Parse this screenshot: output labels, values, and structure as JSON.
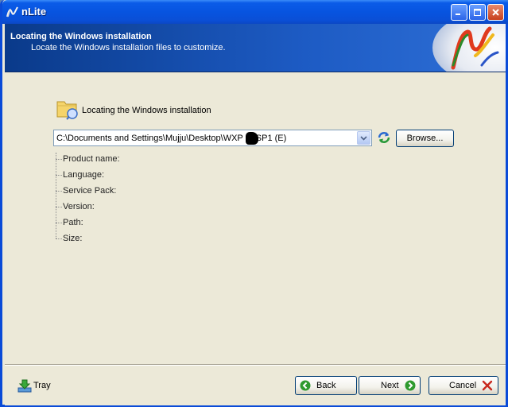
{
  "window": {
    "title": "nLite"
  },
  "header": {
    "title": "Locating the Windows installation",
    "subtitle": "Locate the Windows installation files to customize."
  },
  "section": {
    "label": "Locating the Windows installation"
  },
  "path_combo": {
    "value": "C:\\Documents and Settings\\Mujju\\Desktop\\WXP    SP1 (E)",
    "value_left": "C:\\Documents and Settings\\Mujju\\Desktop\\WXP",
    "value_right": "SP1 (E)"
  },
  "browse_label": "Browse...",
  "info": {
    "items": [
      {
        "label": "Product name:"
      },
      {
        "label": "Language:"
      },
      {
        "label": "Service Pack:"
      },
      {
        "label": "Version:"
      },
      {
        "label": "Path:"
      },
      {
        "label": "Size:"
      }
    ]
  },
  "footer": {
    "tray_label": "Tray",
    "back_label": "Back",
    "next_label": "Next",
    "cancel_label": "Cancel"
  },
  "colors": {
    "titlebar": "#0754e0",
    "header": "#1d5bc4",
    "dialog_bg": "#ece9d8",
    "cancel_x": "#c8281e",
    "nav_green": "#2e9a2e"
  }
}
